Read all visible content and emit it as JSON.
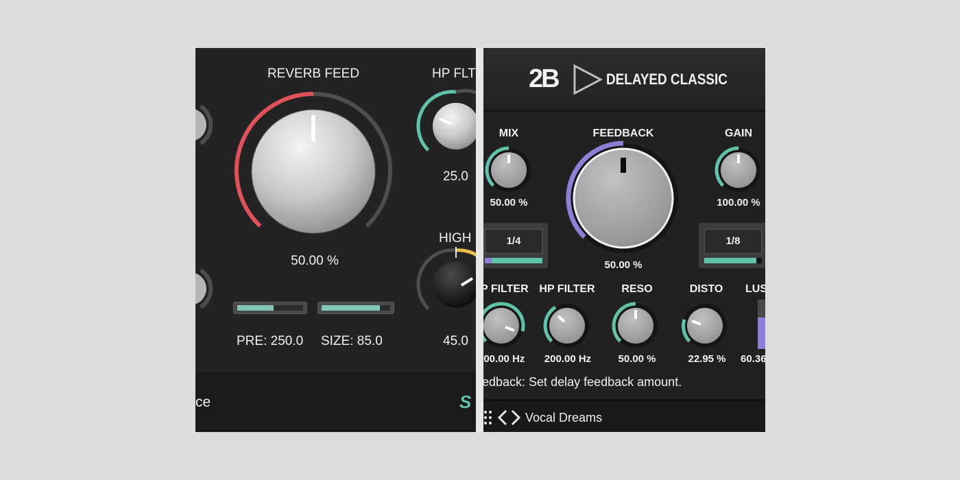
{
  "left_panel": {
    "reverb_feed": {
      "label": "REVERB FEED",
      "value": "50.00 %",
      "level": 0.5
    },
    "hp_flt": {
      "label": "HP FLT",
      "value": "25.0"
    },
    "high": {
      "label": "HIGH",
      "value": "45.0"
    },
    "pre": {
      "label": "PRE:",
      "value": "250.0",
      "level": 0.55
    },
    "size": {
      "label": "SIZE:",
      "value": "85.0",
      "level": 0.85
    },
    "footer_text": "ce",
    "footer_logo": "S",
    "colors": {
      "accent_red": "#e0515a",
      "accent_teal": "#5fc3aa",
      "accent_yellow": "#e6be4a"
    }
  },
  "right_panel": {
    "brand": "2B",
    "play_icon": "play-triangle-icon",
    "title": "DELAYED CLASSIC",
    "mix": {
      "label": "MIX",
      "value": "50.00 %"
    },
    "feedback": {
      "label": "FEEDBACK",
      "value": "50.00 %"
    },
    "gain": {
      "label": "GAIN",
      "value": "100.00 %"
    },
    "time_left": {
      "value": "1/4"
    },
    "time_right": {
      "value": "1/8"
    },
    "lp_filter": {
      "label": "P FILTER",
      "value": "000.00 Hz"
    },
    "hp_filter": {
      "label": "HP FILTER",
      "value": "200.00 Hz"
    },
    "reso": {
      "label": "RESO",
      "value": "50.00 %"
    },
    "disto": {
      "label": "DISTO",
      "value": "22.95 %"
    },
    "lush": {
      "label": "LUS",
      "value": "60.36"
    },
    "hint": "edback: Set delay feedback amount.",
    "preset": {
      "name": "Vocal Dreams",
      "menu_icon": "grid-dots-icon",
      "prev_icon": "chevron-left-icon",
      "next_icon": "chevron-right-icon"
    },
    "colors": {
      "accent_teal": "#5fc3aa",
      "accent_purple": "#8d7fd8"
    }
  }
}
